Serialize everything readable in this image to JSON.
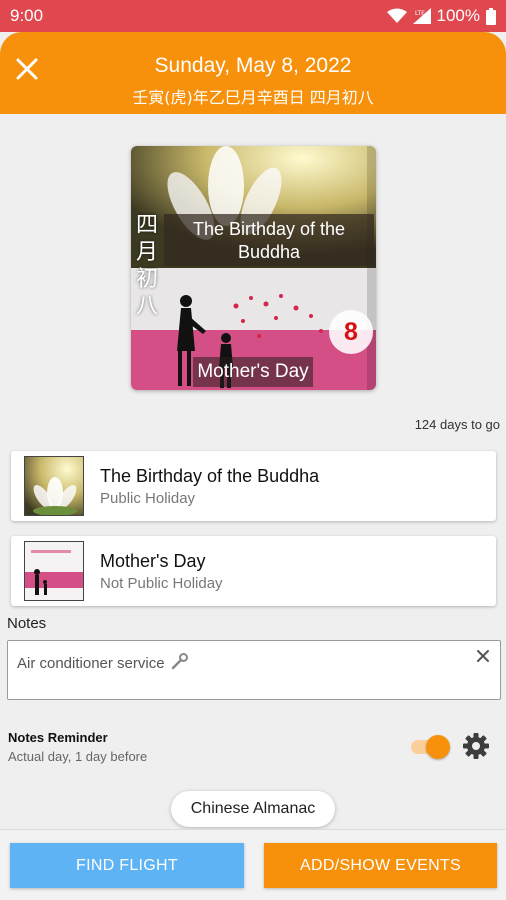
{
  "status_bar": {
    "time": "9:00",
    "battery": "100%",
    "icons": [
      "wifi-icon",
      "signal-icon",
      "battery-icon"
    ]
  },
  "header": {
    "date": "Sunday, May 8, 2022",
    "lunar": "壬寅(虎)年乙巳月辛酉日 四月初八",
    "close_icon": "close-icon"
  },
  "hero": {
    "top_title": "The Birthday of the Buddha",
    "vertical_text": "四\n月\n初\n八",
    "day": "8",
    "bottom_title": "Mother's Day"
  },
  "countdown": "124 days to go",
  "events": [
    {
      "title": "The Birthday of the Buddha",
      "subtitle": "Public Holiday"
    },
    {
      "title": "Mother's Day",
      "subtitle": "Not Public Holiday"
    }
  ],
  "notes": {
    "label": "Notes",
    "value": "Air conditioner service",
    "value_icon": "wrench-icon"
  },
  "reminder": {
    "title": "Notes Reminder",
    "subtitle": "Actual day, 1 day before",
    "enabled": true
  },
  "chip": "Chinese Almanac",
  "buttons": {
    "find_flight": "FIND FLIGHT",
    "add_events": "ADD/SHOW EVENTS"
  },
  "colors": {
    "status_bar": "#e0484f",
    "header": "#f7900a",
    "find_flight": "#5db3f3",
    "add_events": "#f7900a"
  }
}
